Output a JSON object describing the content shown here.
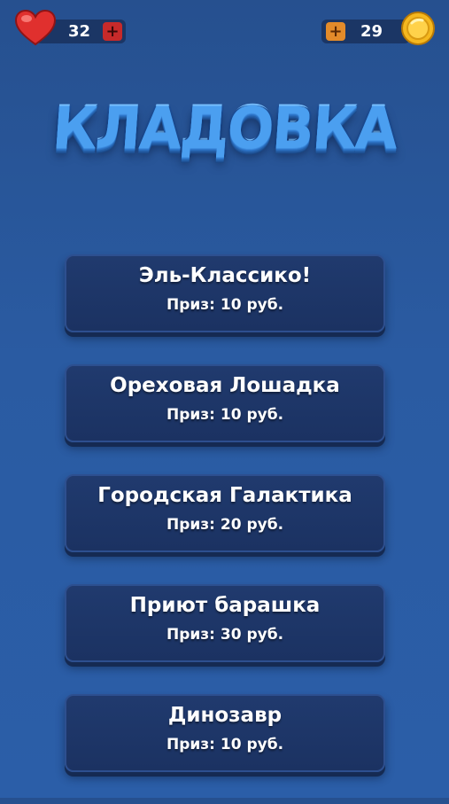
{
  "hud": {
    "lives": "32",
    "coins": "29",
    "plus_symbol": "+",
    "colors": {
      "heart": "#e0302e",
      "coin": "#f5b81f",
      "lives_plus": "#c72a2a",
      "coins_plus": "#e38b2a"
    }
  },
  "title": "КЛАДОВКА",
  "levels": [
    {
      "name": "Эль-Классико!",
      "prize": "Приз: 10 руб."
    },
    {
      "name": "Ореховая Лошадка",
      "prize": "Приз: 10 руб."
    },
    {
      "name": "Городская Галактика",
      "prize": "Приз: 20 руб."
    },
    {
      "name": "Приют барашка",
      "prize": "Приз: 30 руб."
    },
    {
      "name": "Динозавр",
      "prize": "Приз: 10 руб."
    }
  ]
}
